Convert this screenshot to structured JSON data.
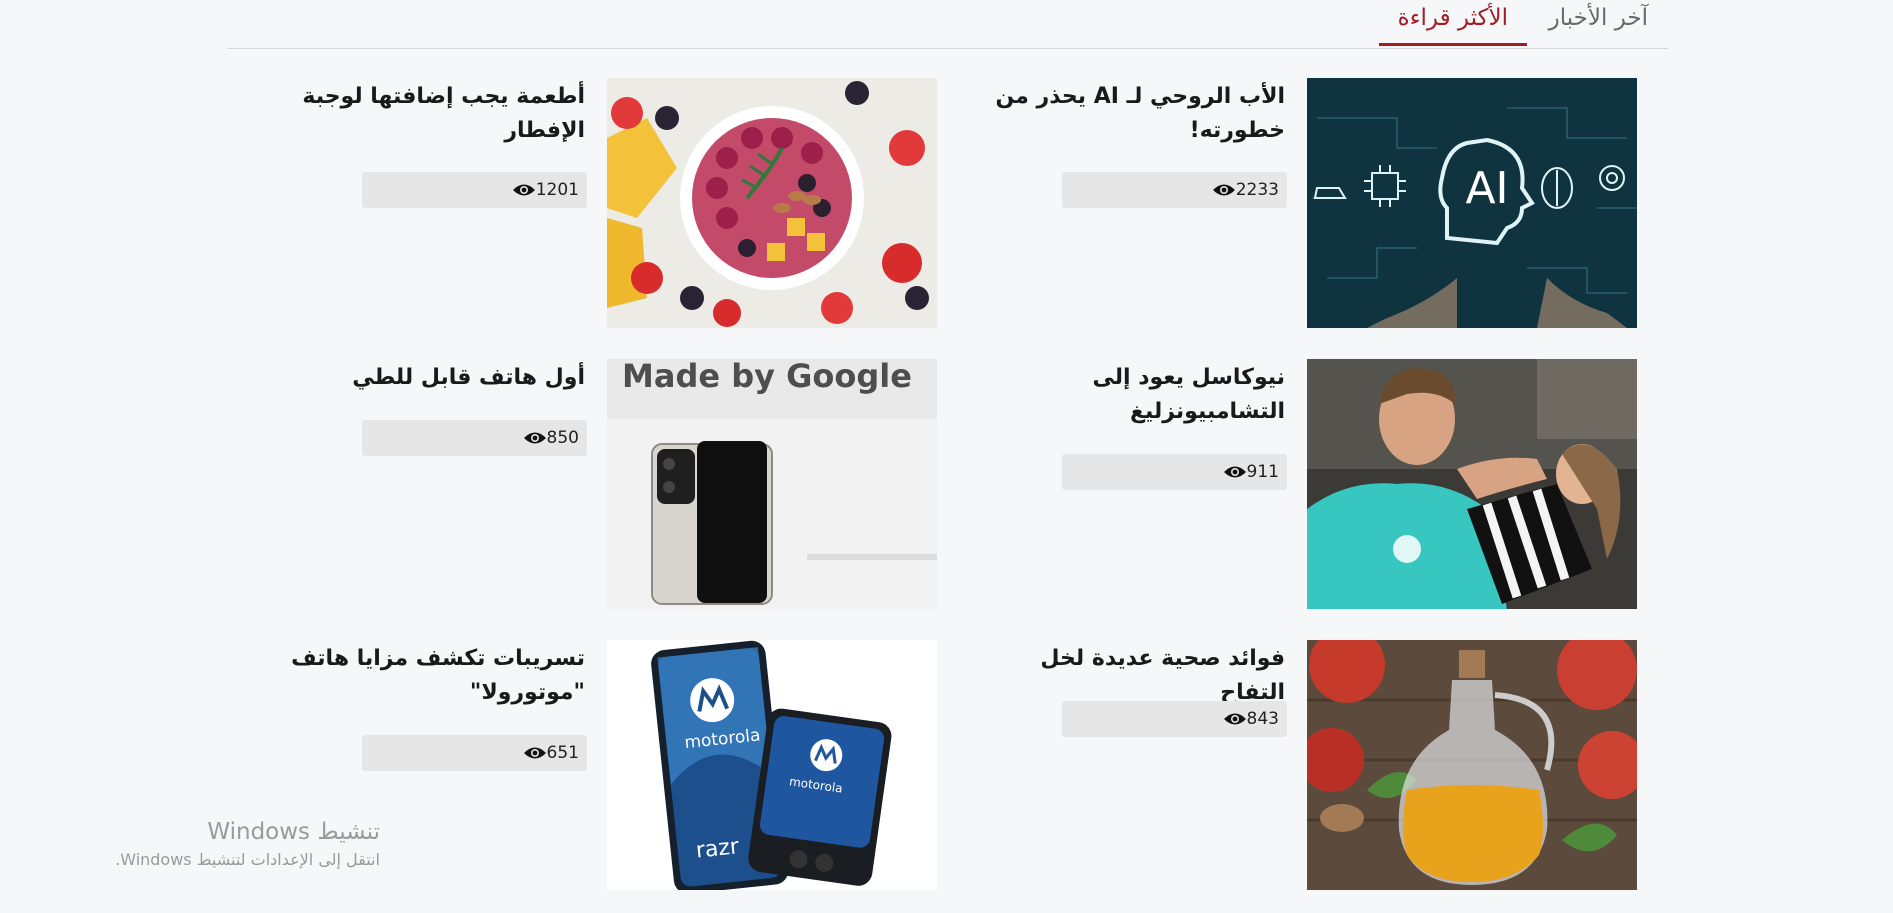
{
  "tabs": [
    {
      "label": "آخر الأخبار",
      "active": false
    },
    {
      "label": "الأكثر قراءة",
      "active": true
    }
  ],
  "accent_color": "#a31d24",
  "articles": [
    {
      "title": "الأب الروحي لـ AI يحذر من خطورته!",
      "views": "2233",
      "image_icon": "ai-brain-image"
    },
    {
      "title": "أطعمة يجب إضافتها لوجبة الإفطار",
      "views": "1201",
      "image_icon": "fruit-bowl-image"
    },
    {
      "title": "نيوكاسل يعود إلى التشامبيونزليغ",
      "views": "911",
      "image_icon": "football-player-image"
    },
    {
      "title": "أول هاتف قابل للطي",
      "views": "850",
      "image_icon": "foldable-phone-image"
    },
    {
      "title": "فوائد صحية عديدة لخل التفاح",
      "views": "843",
      "image_icon": "apple-vinegar-image"
    },
    {
      "title": "تسريبات تكشف مزايا هاتف \"موتورولا\"",
      "views": "651",
      "image_icon": "motorola-phone-image"
    }
  ],
  "image_text": {
    "ai": "AI",
    "google": "Made by Google",
    "motorola": "motorola",
    "razr": "razr"
  },
  "watermark": {
    "title": "تنشيط Windows",
    "subtitle": "انتقل إلى الإعدادات لتنشيط Windows."
  }
}
